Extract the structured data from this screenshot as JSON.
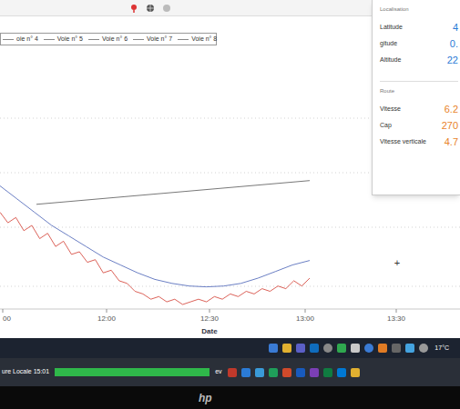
{
  "legend": [
    {
      "label": "oie n° 4"
    },
    {
      "label": "Voie n° 5"
    },
    {
      "label": "Voie n° 6"
    },
    {
      "label": "Voie n° 7"
    },
    {
      "label": "Voie n° 8"
    }
  ],
  "chart": {
    "series": [
      {
        "color": "#d23a2e",
        "values": [
          35,
          31,
          33,
          28,
          30,
          25,
          27,
          22,
          24,
          19,
          20,
          16,
          17,
          12,
          13,
          9,
          8,
          5,
          4,
          2,
          3,
          1,
          2,
          0,
          1,
          2,
          1,
          3,
          2,
          4,
          3,
          5,
          4,
          6,
          5,
          7,
          6,
          9,
          7,
          10
        ]
      },
      {
        "color": "#6b7fc4",
        "values": [
          45,
          40,
          35,
          30,
          26,
          22,
          18,
          15,
          12,
          9.5,
          8,
          7,
          6.7,
          7,
          8,
          10,
          12.5,
          15,
          16.7
        ]
      },
      {
        "color": "#555555",
        "values": [
          38,
          47
        ]
      }
    ],
    "x_ticks": [
      "00",
      "12:00",
      "12:30",
      "13:00",
      "13:30"
    ],
    "axis_title": "Date",
    "cursor": "+"
  },
  "panel": {
    "sections": [
      {
        "title": "Localisation",
        "rows": [
          {
            "label": "Latitude",
            "value": "4",
            "color": "#2b7bd6"
          },
          {
            "label": "gitude",
            "value": "0.",
            "color": "#2b7bd6"
          },
          {
            "label": "Altitude",
            "value": "22",
            "color": "#2b7bd6"
          }
        ]
      },
      {
        "title": "Route",
        "rows": [
          {
            "label": "Vitesse",
            "value": "6.2",
            "color": "#e8832a"
          },
          {
            "label": "Cap",
            "value": "270",
            "color": "#e8832a"
          },
          {
            "label": "Vitesse verticale",
            "value": "4.7",
            "color": "#e8832a"
          }
        ]
      }
    ]
  },
  "status_bar": {
    "text": "ure Locale 15:01",
    "progress": {
      "level": 1
    },
    "label": "ev"
  },
  "taskbar": {
    "weather": "17°C"
  },
  "bezel": {
    "logo": "hp"
  }
}
